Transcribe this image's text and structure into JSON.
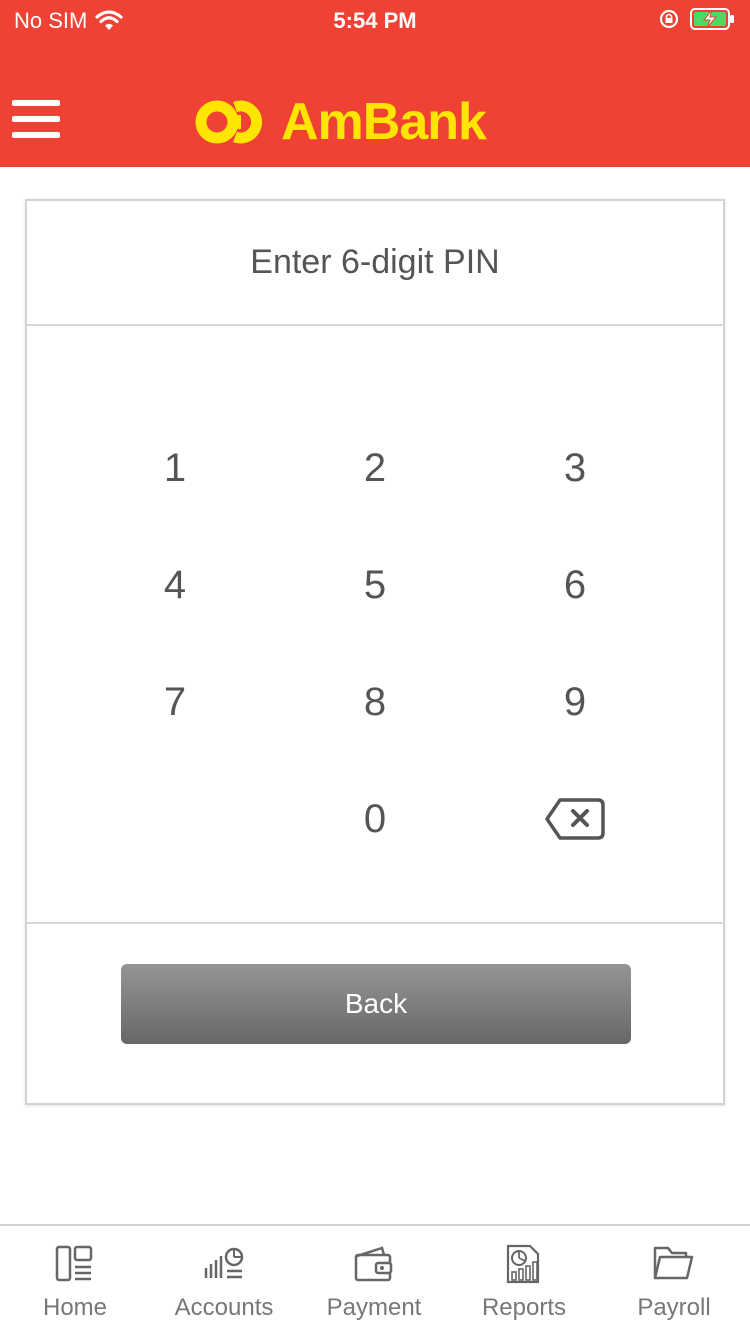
{
  "status_bar": {
    "carrier": "No SIM",
    "time": "5:54 PM"
  },
  "header": {
    "brand": "AmBank",
    "menu_icon": "hamburger-menu-icon",
    "background_color": "#ef4134",
    "logo_color": "#ffe500"
  },
  "pin_card": {
    "title": "Enter 6-digit PIN",
    "keys": [
      "1",
      "2",
      "3",
      "4",
      "5",
      "6",
      "7",
      "8",
      "9",
      "0"
    ],
    "delete_icon": "backspace-icon",
    "back_label": "Back"
  },
  "tabbar": {
    "items": [
      {
        "label": "Home",
        "icon": "home-icon"
      },
      {
        "label": "Accounts",
        "icon": "accounts-icon"
      },
      {
        "label": "Payment",
        "icon": "wallet-icon"
      },
      {
        "label": "Reports",
        "icon": "reports-icon"
      },
      {
        "label": "Payroll",
        "icon": "folder-icon"
      }
    ]
  }
}
